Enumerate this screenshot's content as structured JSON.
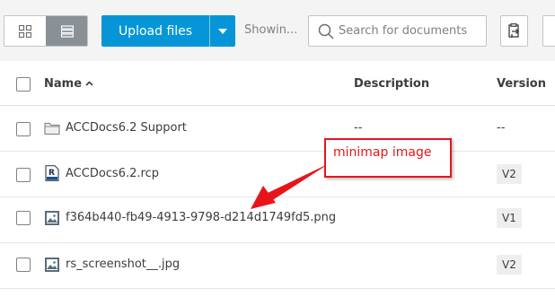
{
  "toolbar": {
    "view_grid_icon": "grid-icon",
    "view_list_icon": "list-icon",
    "upload_label": "Upload files",
    "showing_label": "Showin...",
    "search_placeholder": "Search for documents",
    "export_icon": "export-icon"
  },
  "table": {
    "columns": {
      "name": "Name",
      "description": "Description",
      "version": "Version"
    },
    "rows": [
      {
        "icon": "folder-icon",
        "name": "ACCDocs6.2 Support",
        "description": "--",
        "version": "--"
      },
      {
        "icon": "revit-file-icon",
        "name": "ACCDocs6.2.rcp",
        "description": "",
        "version": "V2"
      },
      {
        "icon": "image-file-icon",
        "name": "f364b440-fb49-4913-9798-d214d1749fd5.png",
        "description": "",
        "version": "V1"
      },
      {
        "icon": "image-file-icon",
        "name": "rs_screenshot__.jpg",
        "description": "",
        "version": "V2"
      }
    ]
  },
  "annotation": {
    "label": "minimap image",
    "color": "#e8141c"
  },
  "colors": {
    "accent": "#0696d7",
    "annotation_red": "#e8141c"
  }
}
